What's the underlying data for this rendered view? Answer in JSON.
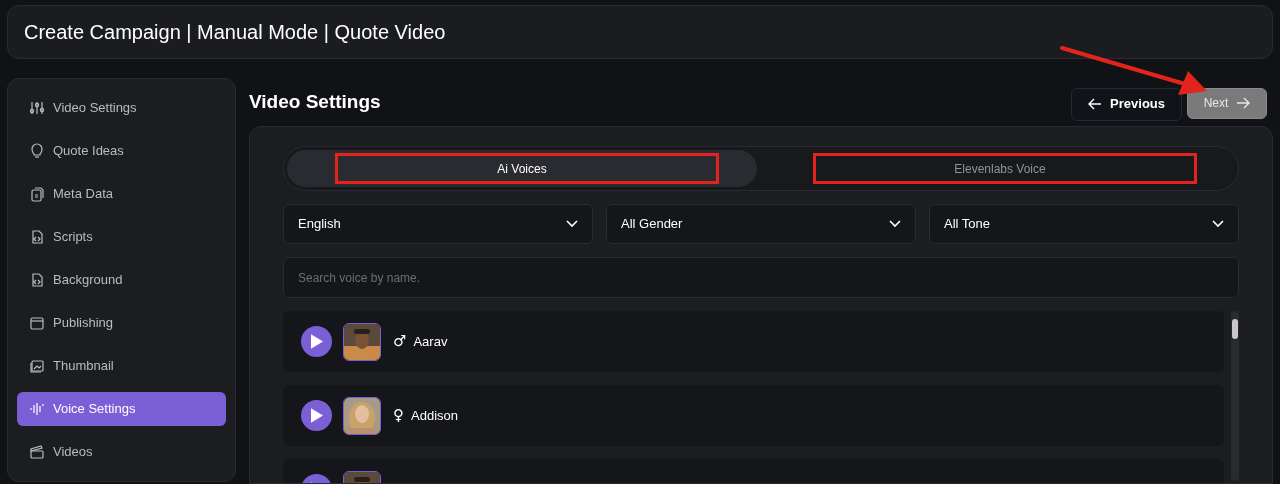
{
  "header": {
    "title": "Create Campaign | Manual Mode | Quote Video"
  },
  "sidebar": {
    "items": [
      {
        "kind": "sliders",
        "label": "Video Settings",
        "selected": false
      },
      {
        "kind": "bulb",
        "label": "Quote Ideas",
        "selected": false
      },
      {
        "kind": "files",
        "label": "Meta Data",
        "selected": false
      },
      {
        "kind": "code",
        "label": "Scripts",
        "selected": false
      },
      {
        "kind": "code",
        "label": "Background",
        "selected": false
      },
      {
        "kind": "calendar",
        "label": "Publishing",
        "selected": false
      },
      {
        "kind": "images",
        "label": "Thumbnail",
        "selected": false
      },
      {
        "kind": "wave",
        "label": "Voice Settings",
        "selected": true
      },
      {
        "kind": "clapper",
        "label": "Videos",
        "selected": false
      }
    ]
  },
  "page": {
    "heading": "Video Settings",
    "previous_button": "Previous",
    "next_button": {
      "label": "Next",
      "disabled": true,
      "annotated": true
    }
  },
  "voice_tabs": [
    {
      "label": "Ai Voices",
      "selected": true,
      "annotated": true
    },
    {
      "label": "Elevenlabs Voice",
      "selected": false,
      "annotated": true
    }
  ],
  "filters": [
    {
      "value": "English"
    },
    {
      "value": "All Gender"
    },
    {
      "value": "All Tone"
    }
  ],
  "search": {
    "placeholder": "Search voice by name."
  },
  "voices": [
    {
      "symbol": "♂",
      "name": "Aarav",
      "avatar": {
        "kind": "picture"
      }
    },
    {
      "symbol": "♀",
      "name": "Addison",
      "avatar": {
        "kind": "picture"
      }
    },
    {
      "avatar": {
        "kind": "picture"
      }
    }
  ]
}
